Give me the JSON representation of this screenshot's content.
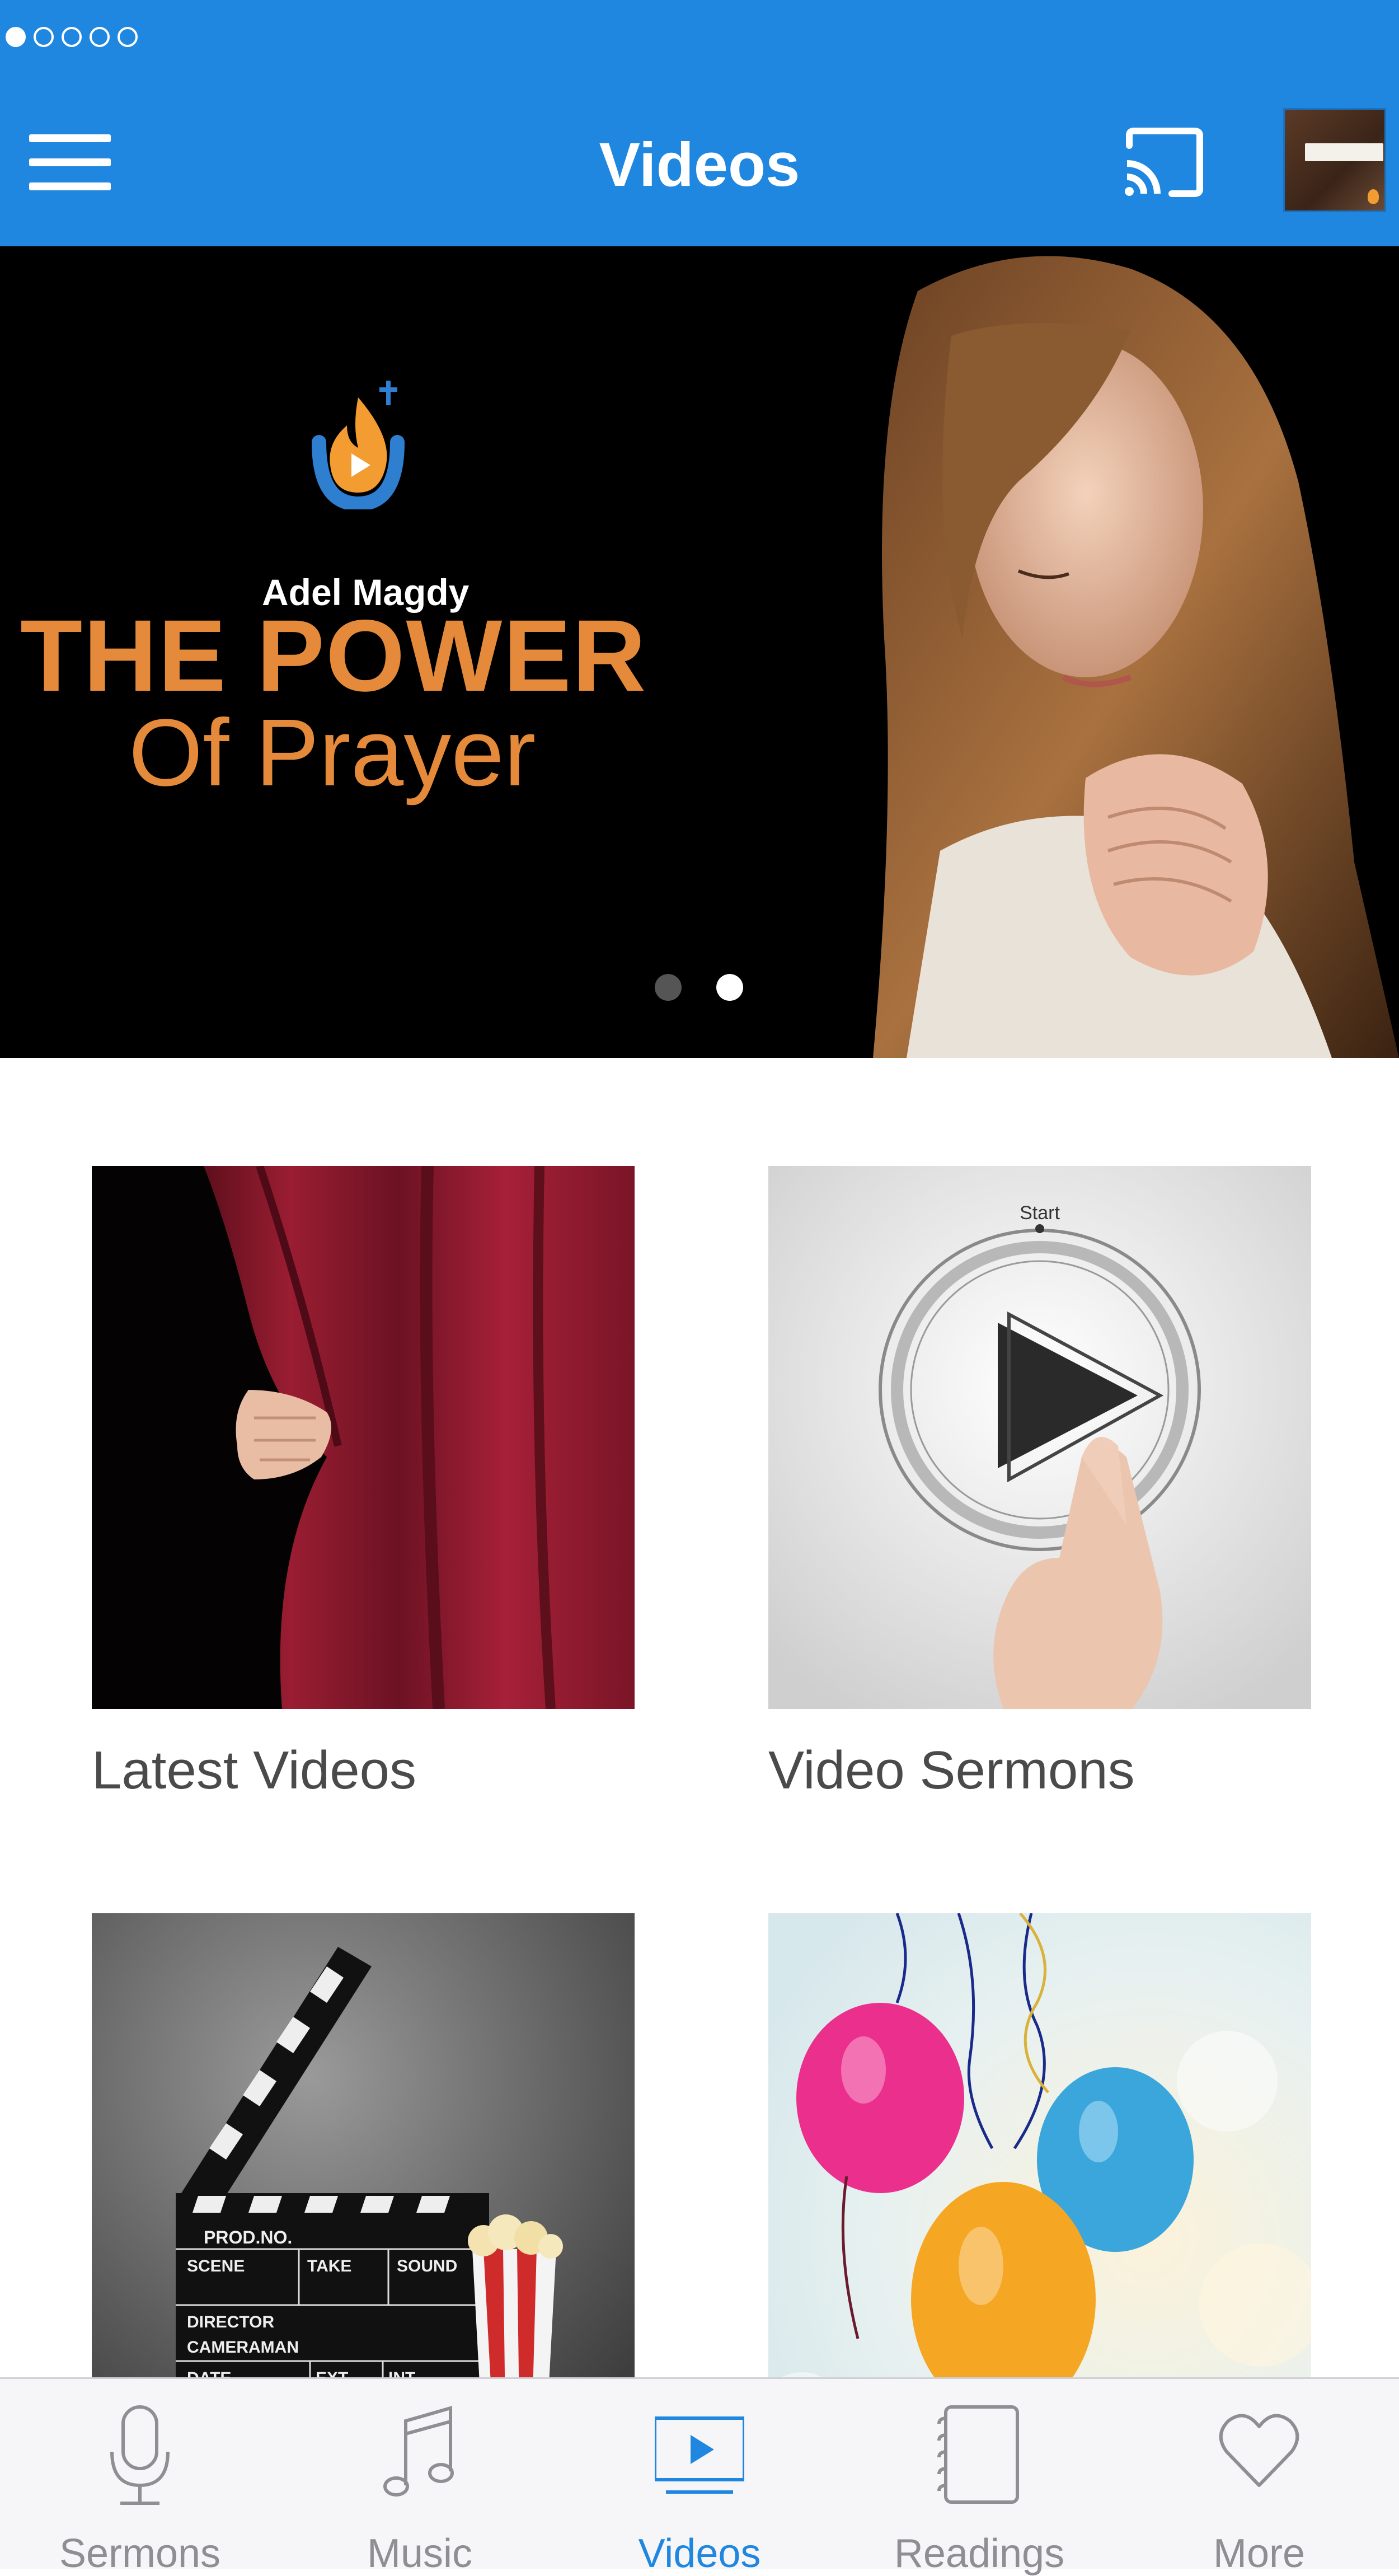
{
  "nav": {
    "title": "Videos"
  },
  "banner": {
    "author": "Adel Magdy",
    "headline": "THE POWER",
    "subline": "Of Prayer",
    "page_count": 2,
    "active_page": 2
  },
  "categories": [
    {
      "label": "Latest Videos"
    },
    {
      "label": "Video Sermons"
    }
  ],
  "tabs": [
    {
      "label": "Sermons",
      "icon": "microphone-icon"
    },
    {
      "label": "Music",
      "icon": "music-note-icon"
    },
    {
      "label": "Videos",
      "icon": "video-player-icon",
      "active": true
    },
    {
      "label": "Readings",
      "icon": "notebook-icon"
    },
    {
      "label": "More",
      "icon": "heart-icon"
    }
  ],
  "colors": {
    "accent": "#1f87e0",
    "headline": "#e58a3a",
    "inactive_tab": "#8e8e93"
  }
}
